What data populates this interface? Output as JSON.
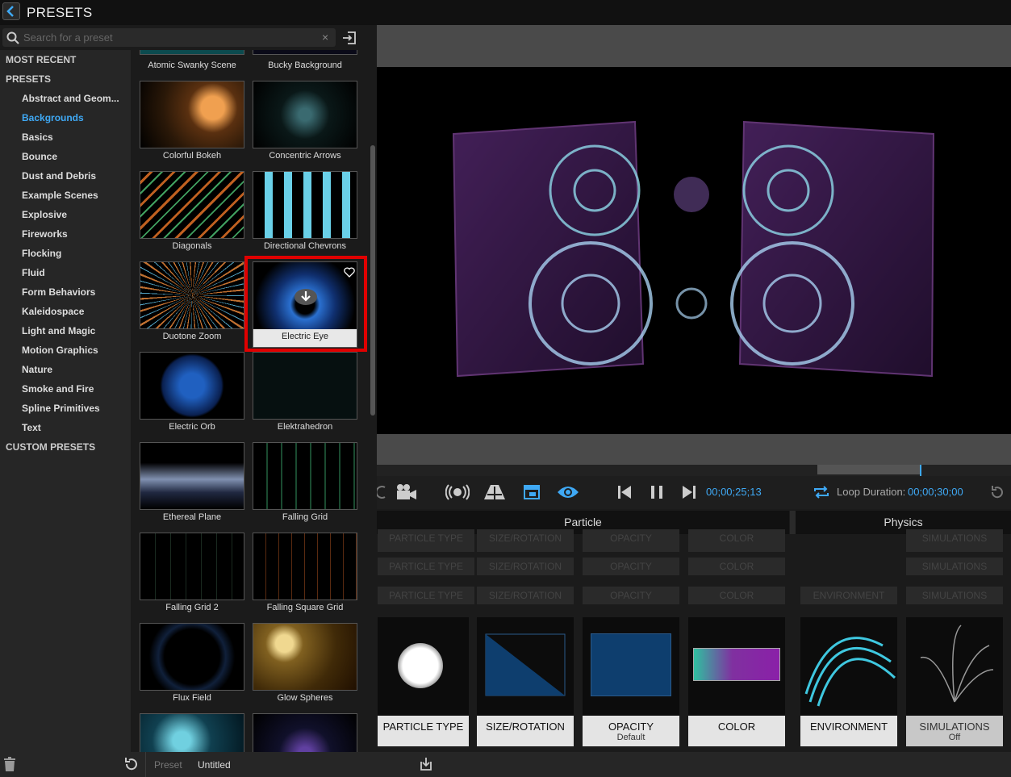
{
  "header": {
    "title": "PRESETS"
  },
  "search": {
    "placeholder": "Search for a preset"
  },
  "sidebar": {
    "most_recent": "MOST RECENT",
    "presets": "PRESETS",
    "items": [
      "Abstract and Geom...",
      "Backgrounds",
      "Basics",
      "Bounce",
      "Dust and Debris",
      "Example Scenes",
      "Explosive",
      "Fireworks",
      "Flocking",
      "Fluid",
      "Form Behaviors",
      "Kaleidospace",
      "Light and Magic",
      "Motion Graphics",
      "Nature",
      "Smoke and Fire",
      "Spline Primitives",
      "Text"
    ],
    "selected": "Backgrounds",
    "custom": "CUSTOM PRESETS"
  },
  "presets": [
    "Atomic Swanky Scene",
    "Bucky Background",
    "Colorful Bokeh",
    "Concentric Arrows",
    "Diagonals",
    "Directional Chevrons",
    "Duotone Zoom",
    "Electric Eye",
    "Electric Orb",
    "Elektrahedron",
    "Ethereal Plane",
    "Falling Grid",
    "Falling Grid 2",
    "Falling Square Grid",
    "Flux Field",
    "Glow Spheres"
  ],
  "transport": {
    "time": "00;00;25;13",
    "loop_label": "Loop Duration:",
    "loop_value": "00;00;30;00"
  },
  "panels": {
    "particle": "Particle",
    "physics": "Physics"
  },
  "tabs": {
    "particle_type": "PARTICLE TYPE",
    "size_rotation": "SIZE/ROTATION",
    "opacity": "OPACITY",
    "color": "COLOR",
    "environment": "ENVIRONMENT",
    "simulations": "SIMULATIONS",
    "off": "Off"
  },
  "cards": {
    "particle_type": "PARTICLE TYPE",
    "size_rotation": "SIZE/ROTATION",
    "opacity": "OPACITY",
    "opacity_sub": "Default",
    "color": "COLOR",
    "environment": "ENVIRONMENT",
    "simulations": "SIMULATIONS",
    "simulations_sub": "Off"
  },
  "footer": {
    "preset_label": "Preset",
    "preset_value": "Untitled"
  },
  "colors": {
    "accent": "#3fa9f5",
    "highlight": "#e00000"
  }
}
